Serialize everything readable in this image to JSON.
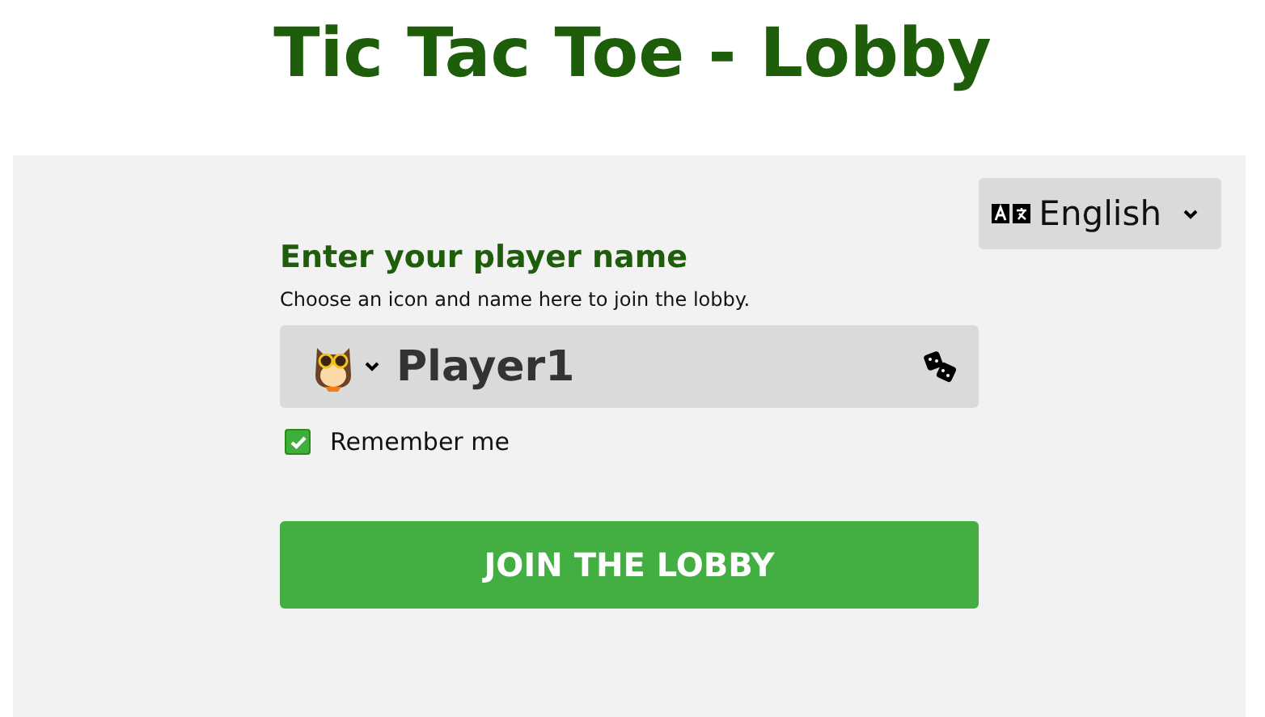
{
  "title": "Tic Tac Toe - Lobby",
  "language": {
    "label": "English"
  },
  "form": {
    "heading": "Enter your player name",
    "hint": "Choose an icon and name here to join the lobby.",
    "name": "Player1",
    "remember": {
      "label": "Remember me",
      "checked": true
    },
    "submit": "JOIN THE LOBBY"
  }
}
